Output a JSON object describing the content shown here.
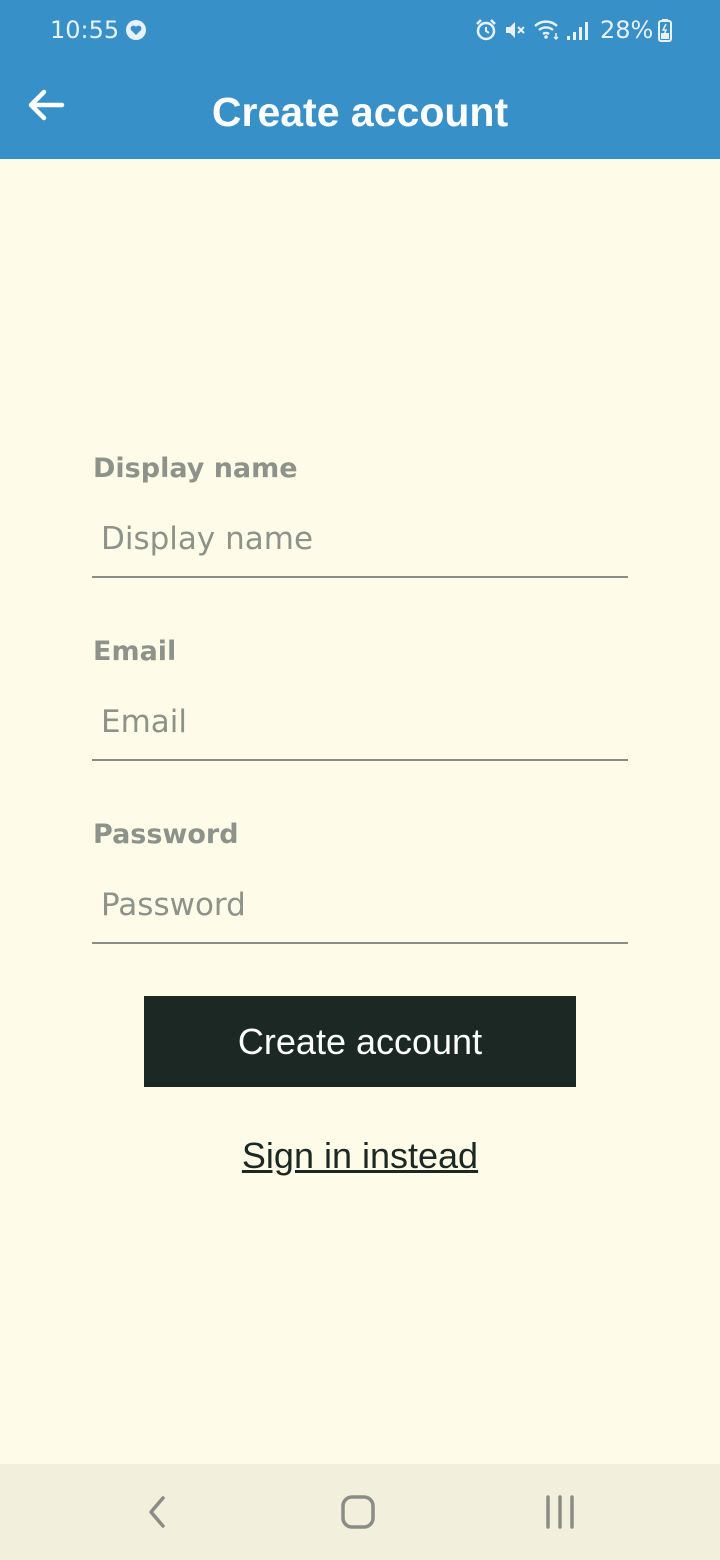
{
  "status_bar": {
    "time": "10:55",
    "battery_percent": "28%",
    "icons": [
      "heart-icon",
      "alarm-icon",
      "mute-icon",
      "wifi-icon",
      "signal-icon",
      "battery-icon"
    ]
  },
  "app_bar": {
    "title": "Create account",
    "back_icon": "arrow-left-icon",
    "background": "#3890C9"
  },
  "form": {
    "display_name": {
      "label": "Display name",
      "placeholder": "Display name",
      "value": ""
    },
    "email": {
      "label": "Email",
      "placeholder": "Email",
      "value": ""
    },
    "password": {
      "label": "Password",
      "placeholder": "Password",
      "value": ""
    },
    "submit_label": "Create account",
    "signin_link": "Sign in instead"
  },
  "colors": {
    "page_background": "#FEFCE8",
    "button_background": "#1B2823",
    "label_color": "#8D938A"
  },
  "nav_bar": {
    "icons": [
      "nav-back-icon",
      "nav-home-icon",
      "nav-recents-icon"
    ]
  }
}
